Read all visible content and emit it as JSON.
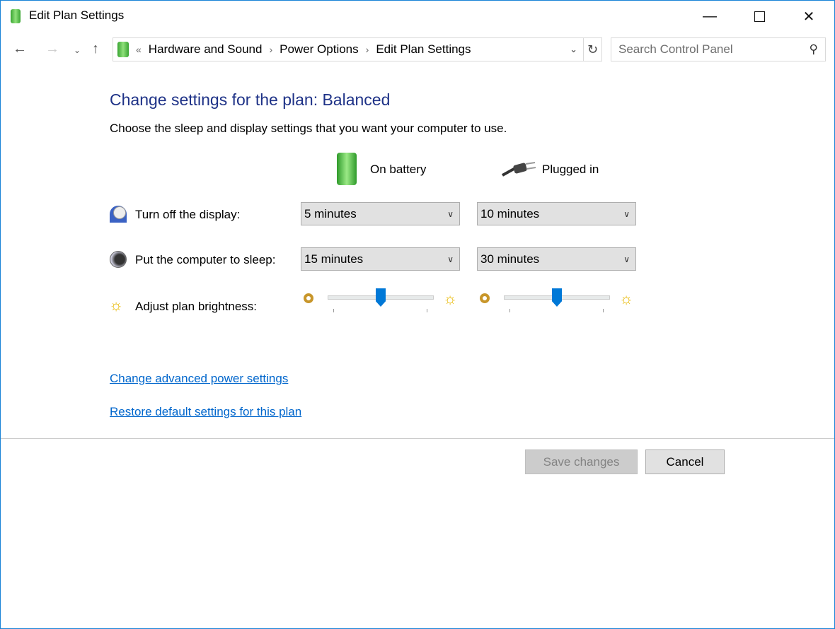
{
  "window": {
    "title": "Edit Plan Settings"
  },
  "address": {
    "overflow": "«",
    "crumbs": [
      "Hardware and Sound",
      "Power Options",
      "Edit Plan Settings"
    ]
  },
  "search": {
    "placeholder": "Search Control Panel"
  },
  "main": {
    "heading": "Change settings for the plan: Balanced",
    "subtitle": "Choose the sleep and display settings that you want your computer to use.",
    "columns": [
      "On battery",
      "Plugged in"
    ],
    "rows": [
      {
        "label": "Turn off the display:",
        "battery": "5 minutes",
        "plugged": "10 minutes"
      },
      {
        "label": "Put the computer to sleep:",
        "battery": "15 minutes",
        "plugged": "30 minutes"
      }
    ],
    "brightness": {
      "label": "Adjust plan brightness:",
      "battery_percent": 50,
      "plugged_percent": 50
    },
    "links": [
      "Change advanced power settings",
      "Restore default settings for this plan"
    ]
  },
  "buttons": {
    "save": "Save changes",
    "save_enabled": false,
    "cancel": "Cancel"
  },
  "colors": {
    "accent": "#0078d7",
    "heading": "#1e3287",
    "link": "#0066cc"
  }
}
